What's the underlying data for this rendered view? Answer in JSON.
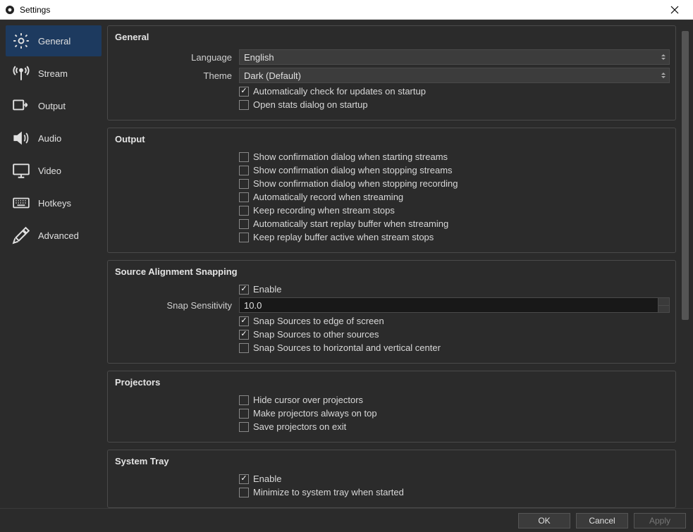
{
  "window": {
    "title": "Settings"
  },
  "sidebar": {
    "items": [
      {
        "label": "General"
      },
      {
        "label": "Stream"
      },
      {
        "label": "Output"
      },
      {
        "label": "Audio"
      },
      {
        "label": "Video"
      },
      {
        "label": "Hotkeys"
      },
      {
        "label": "Advanced"
      }
    ]
  },
  "general": {
    "title": "General",
    "language_label": "Language",
    "language_value": "English",
    "theme_label": "Theme",
    "theme_value": "Dark (Default)",
    "auto_update": "Automatically check for updates on startup",
    "open_stats": "Open stats dialog on startup"
  },
  "output": {
    "title": "Output",
    "confirm_start": "Show confirmation dialog when starting streams",
    "confirm_stop": "Show confirmation dialog when stopping streams",
    "confirm_stop_rec": "Show confirmation dialog when stopping recording",
    "auto_record": "Automatically record when streaming",
    "keep_recording": "Keep recording when stream stops",
    "auto_replay": "Automatically start replay buffer when streaming",
    "keep_replay": "Keep replay buffer active when stream stops"
  },
  "snapping": {
    "title": "Source Alignment Snapping",
    "enable": "Enable",
    "sensitivity_label": "Snap Sensitivity",
    "sensitivity_value": "10.0",
    "edge": "Snap Sources to edge of screen",
    "other": "Snap Sources to other sources",
    "center": "Snap Sources to horizontal and vertical center"
  },
  "projectors": {
    "title": "Projectors",
    "hide_cursor": "Hide cursor over projectors",
    "always_top": "Make projectors always on top",
    "save_exit": "Save projectors on exit"
  },
  "systray": {
    "title": "System Tray",
    "enable": "Enable",
    "minimize": "Minimize to system tray when started"
  },
  "buttons": {
    "ok": "OK",
    "cancel": "Cancel",
    "apply": "Apply"
  }
}
